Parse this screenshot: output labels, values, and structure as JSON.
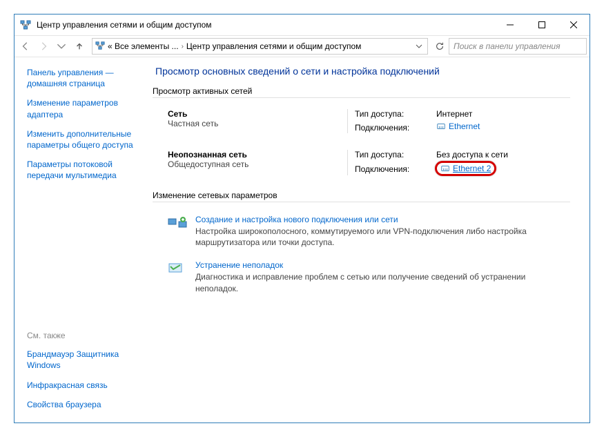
{
  "window": {
    "title": "Центр управления сетями и общим доступом"
  },
  "addressbar": {
    "crumb1": "« Все элементы ...",
    "crumb2": "Центр управления сетями и общим доступом"
  },
  "search": {
    "placeholder": "Поиск в панели управления"
  },
  "sidebar": {
    "links": [
      "Панель управления — домашняя страница",
      "Изменение параметров адаптера",
      "Изменить дополнительные параметры общего доступа",
      "Параметры потоковой передачи мультимедиа"
    ],
    "see_also_label": "См. также",
    "see_also": [
      "Брандмауэр Защитника Windows",
      "Инфракрасная связь",
      "Свойства браузера"
    ]
  },
  "main": {
    "heading": "Просмотр основных сведений о сети и настройка подключений",
    "active_networks_label": "Просмотр активных сетей",
    "networks": [
      {
        "name": "Сеть",
        "type": "Частная сеть",
        "access_label": "Тип доступа:",
        "access_value": "Интернет",
        "conn_label": "Подключения:",
        "conn_value": "Ethernet"
      },
      {
        "name": "Неопознанная сеть",
        "type": "Общедоступная сеть",
        "access_label": "Тип доступа:",
        "access_value": "Без доступа к сети",
        "conn_label": "Подключения:",
        "conn_value": "Ethernet 2"
      }
    ],
    "change_settings_label": "Изменение сетевых параметров",
    "actions": [
      {
        "title": "Создание и настройка нового подключения или сети",
        "desc": "Настройка широкополосного, коммутируемого или VPN-подключения либо настройка маршрутизатора или точки доступа."
      },
      {
        "title": "Устранение неполадок",
        "desc": "Диагностика и исправление проблем с сетью или получение сведений об устранении неполадок."
      }
    ]
  }
}
